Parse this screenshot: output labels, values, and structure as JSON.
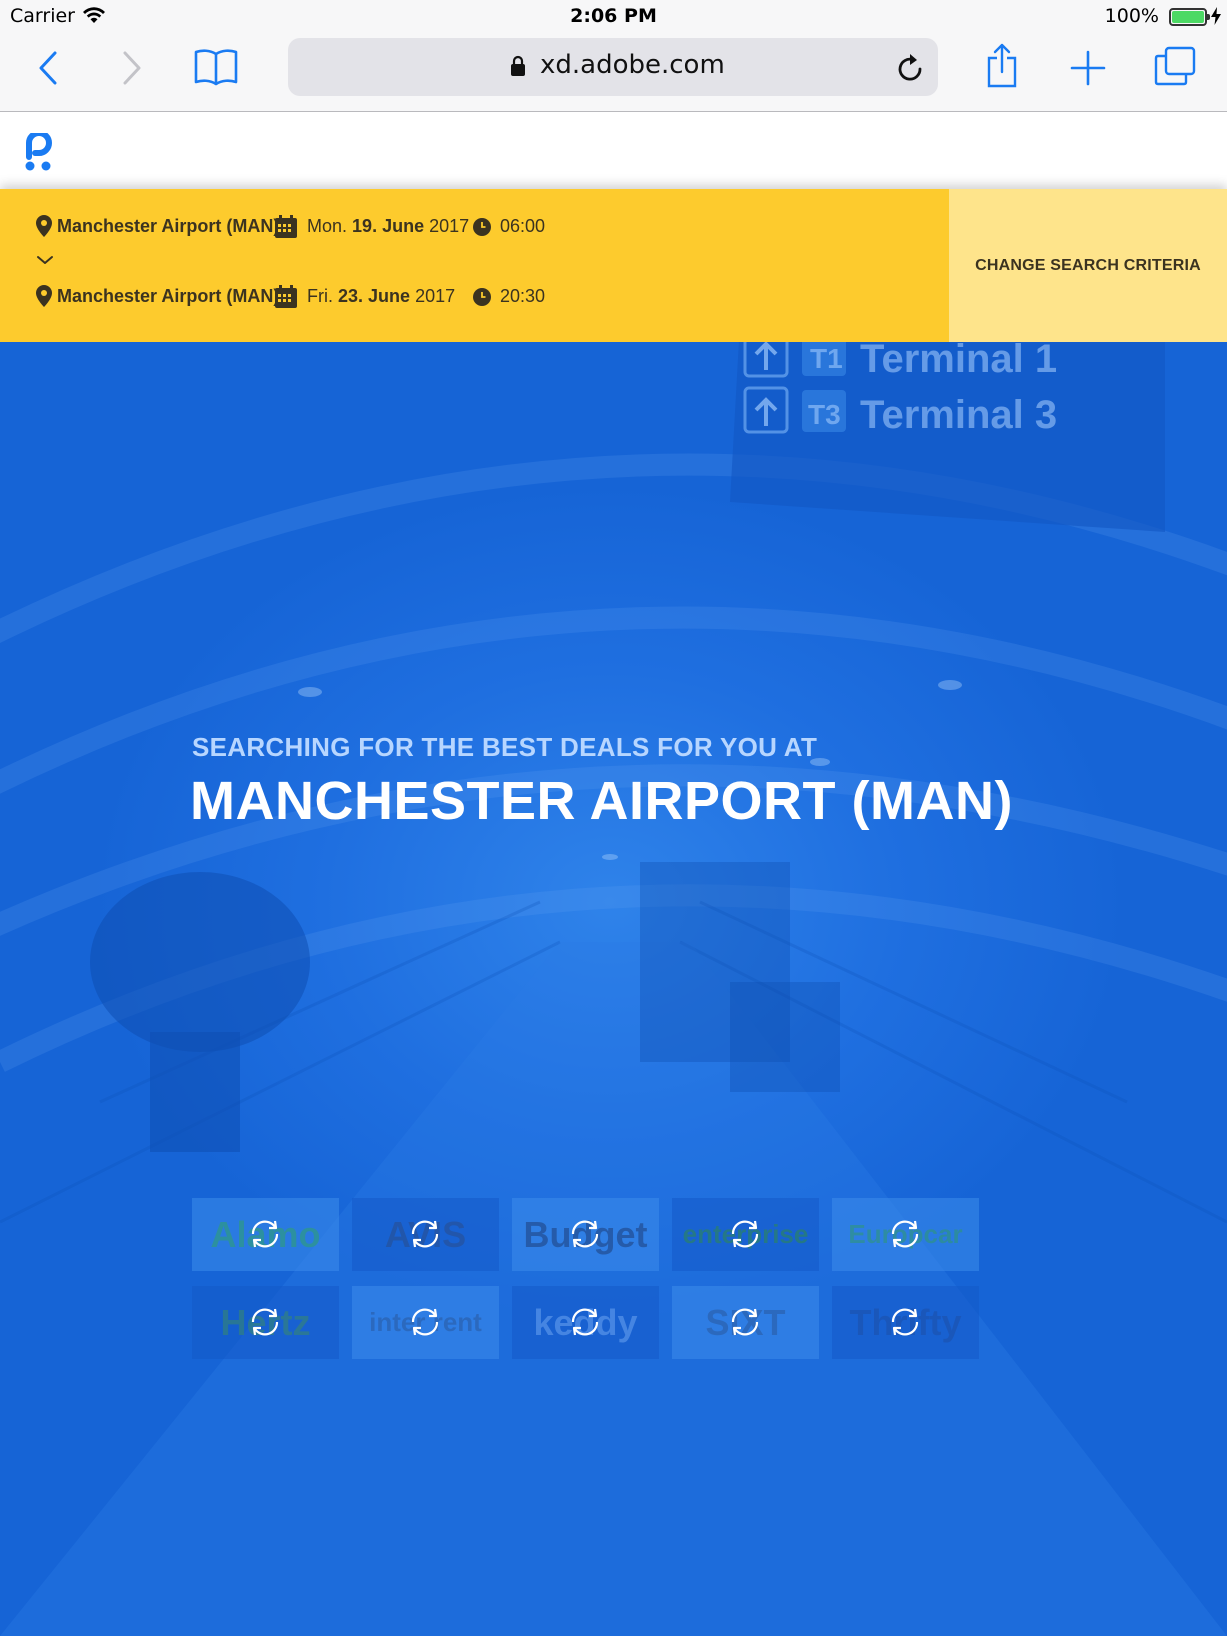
{
  "status_bar": {
    "carrier": "Carrier",
    "time": "2:06 PM",
    "battery": "100%",
    "battery_level": 1.0
  },
  "browser": {
    "url": "xd.adobe.com",
    "icons": [
      "back-icon",
      "forward-icon",
      "bookmarks-icon",
      "lock-icon",
      "reload-icon",
      "share-icon",
      "new-tab-icon",
      "tabs-icon"
    ]
  },
  "summary": {
    "pickup": {
      "location": "Manchester Airport (MAN)",
      "weekday": "Mon.",
      "day_month": "19. June",
      "year": "2017",
      "time": "06:00"
    },
    "dropoff": {
      "location": "Manchester Airport (MAN)",
      "weekday": "Fri.",
      "day_month": "23. June",
      "year": "2017",
      "time": "20:30"
    },
    "change_label": "CHANGE SEARCH CRITERIA"
  },
  "hero": {
    "kicker": "SEARCHING FOR THE BEST DEALS FOR YOU AT",
    "headline": "MANCHESTER AIRPORT (MAN)",
    "background_sign": {
      "terminal1_badge": "T1",
      "terminal1": "Terminal 1",
      "terminal3_badge": "T3",
      "terminal3": "Terminal 3"
    }
  },
  "providers": [
    {
      "name": "Alamo",
      "color": "#2fa36b"
    },
    {
      "name": "AVIS",
      "color": "#2a4d8c"
    },
    {
      "name": "Budget",
      "color": "#1d3f7a"
    },
    {
      "name": "enterprise",
      "color": "#2f8a4a"
    },
    {
      "name": "Europcar",
      "color": "#2f9a6e"
    },
    {
      "name": "Hertz",
      "color": "#3a8a6a"
    },
    {
      "name": "inter rent",
      "color": "#2a5aa0"
    },
    {
      "name": "keddy",
      "color": "#6aa3f0"
    },
    {
      "name": "SIXT",
      "color": "#2a5aa0"
    },
    {
      "name": "Thrifty",
      "color": "#1d4fa8"
    }
  ],
  "colors": {
    "accent_yellow": "#fdcb2d",
    "change_button": "#fee48b",
    "hero_blue": "#1c6fe0",
    "logo_blue": "#1a7bf2"
  }
}
